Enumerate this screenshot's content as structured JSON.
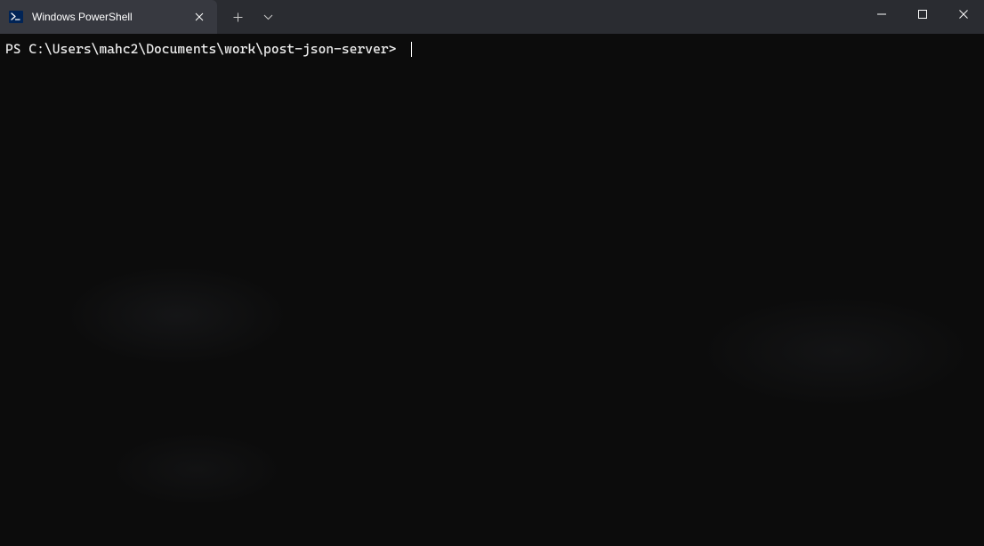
{
  "tab": {
    "title": "Windows PowerShell"
  },
  "terminal": {
    "prompt": "PS C:\\Users\\mahc2\\Documents\\work\\post-json-server> "
  }
}
